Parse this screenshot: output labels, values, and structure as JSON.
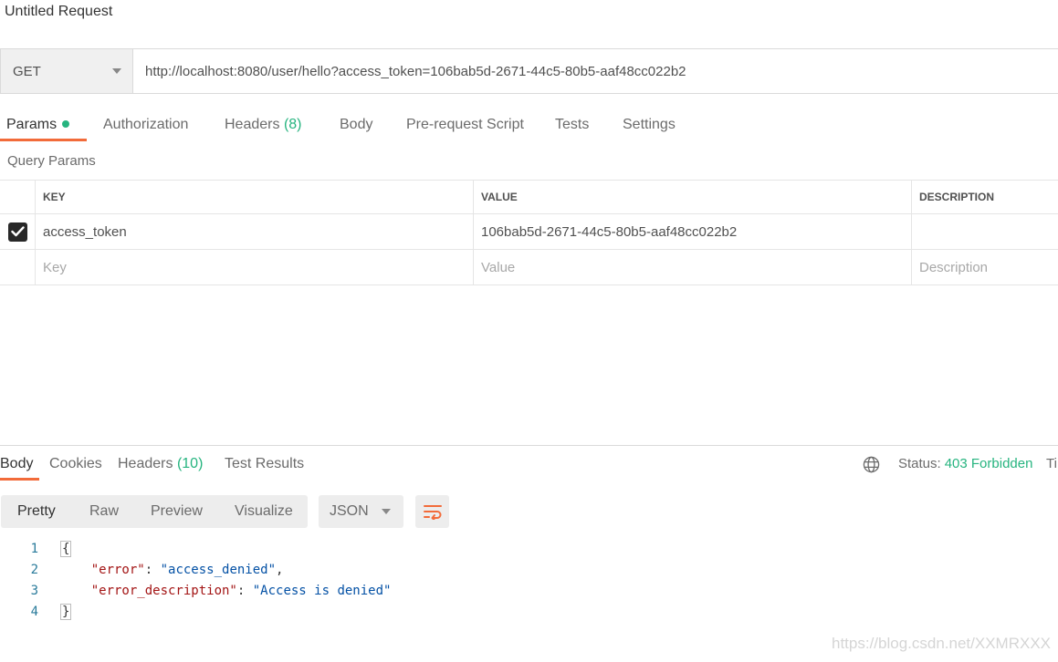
{
  "request": {
    "title": "Untitled Request"
  },
  "url_bar": {
    "method": "GET",
    "url": "http://localhost:8080/user/hello?access_token=106bab5d-2671-44c5-80b5-aaf48cc022b2"
  },
  "request_tabs": {
    "params": "Params",
    "authorization": "Authorization",
    "headers": "Headers",
    "headers_count": "(8)",
    "body": "Body",
    "prerequest": "Pre-request Script",
    "tests": "Tests",
    "settings": "Settings"
  },
  "query_params": {
    "label": "Query Params",
    "columns": {
      "key": "KEY",
      "value": "VALUE",
      "description": "DESCRIPTION"
    },
    "rows": [
      {
        "checked": true,
        "key": "access_token",
        "value": "106bab5d-2671-44c5-80b5-aaf48cc022b2",
        "description": ""
      }
    ],
    "placeholders": {
      "key": "Key",
      "value": "Value",
      "description": "Description"
    }
  },
  "response_tabs": {
    "body": "Body",
    "cookies": "Cookies",
    "headers": "Headers",
    "headers_count": "(10)",
    "test_results": "Test Results"
  },
  "status": {
    "label": "Status:",
    "value": "403 Forbidden",
    "value_color": "#26b47f",
    "time_label": "Tin"
  },
  "response_view": {
    "modes": [
      "Pretty",
      "Raw",
      "Preview",
      "Visualize"
    ],
    "active_mode": "Pretty",
    "format": "JSON"
  },
  "response_body": {
    "line_numbers": [
      "1",
      "2",
      "3",
      "4"
    ],
    "open_brace": "{",
    "close_brace": "}",
    "error_key": "\"error\"",
    "error_value": "\"access_denied\"",
    "desc_key": "\"error_description\"",
    "desc_value": "\"Access is denied\""
  },
  "watermark": "https://blog.csdn.net/XXMRXXX",
  "colors": {
    "accent": "#f26b3a",
    "success": "#26b47f"
  }
}
